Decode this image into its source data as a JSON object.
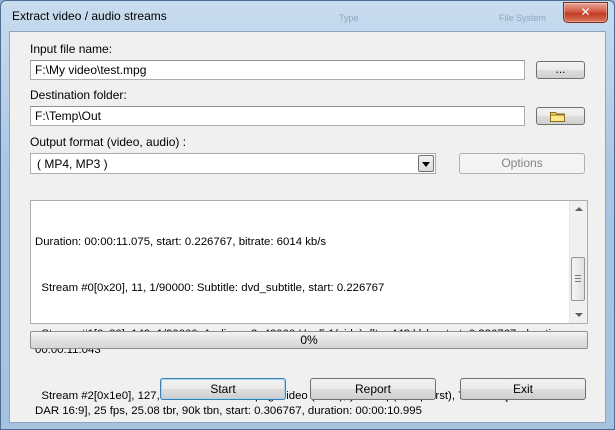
{
  "window": {
    "title": "Extract video / audio streams",
    "close_glyph": "✕"
  },
  "background_ghost": {
    "type": "Type",
    "file_system": "File System"
  },
  "input_file": {
    "label": "Input file name:",
    "value": "F:\\My video\\test.mpg",
    "browse_label": "..."
  },
  "destination": {
    "label": "Destination folder:",
    "value": "F:\\Temp\\Out",
    "browse_icon": "folder-icon"
  },
  "output_format": {
    "label": "Output format (video, audio) :",
    "selected": "( MP4, MP3 )",
    "options_label": "Options"
  },
  "log": {
    "lines": [
      "Duration: 00:00:11.075, start: 0.226767, bitrate: 6014 kb/s",
      "  Stream #0[0x20], 11, 1/90000: Subtitle: dvd_subtitle, start: 0.226767",
      "  Stream #1[0x80], 149, 1/90000: Audio: ac3, 48000 Hz, 5.1(side), fltp, 448 kb/s, start: 0.226767, duration: 00:00:11.043",
      "  Stream #2[0x1e0], 127, 1/90000: Video: mpeg2video (Main), yuv420p(tv, top first), 720x576 [SAR 64:45 DAR 16:9], 25 fps, 25.08 tbr, 90k tbn, start: 0.306767, duration: 00:00:10.995"
    ]
  },
  "progress": {
    "text": "0%",
    "value": 0
  },
  "buttons": {
    "start": "Start",
    "report": "Report",
    "exit": "Exit"
  }
}
